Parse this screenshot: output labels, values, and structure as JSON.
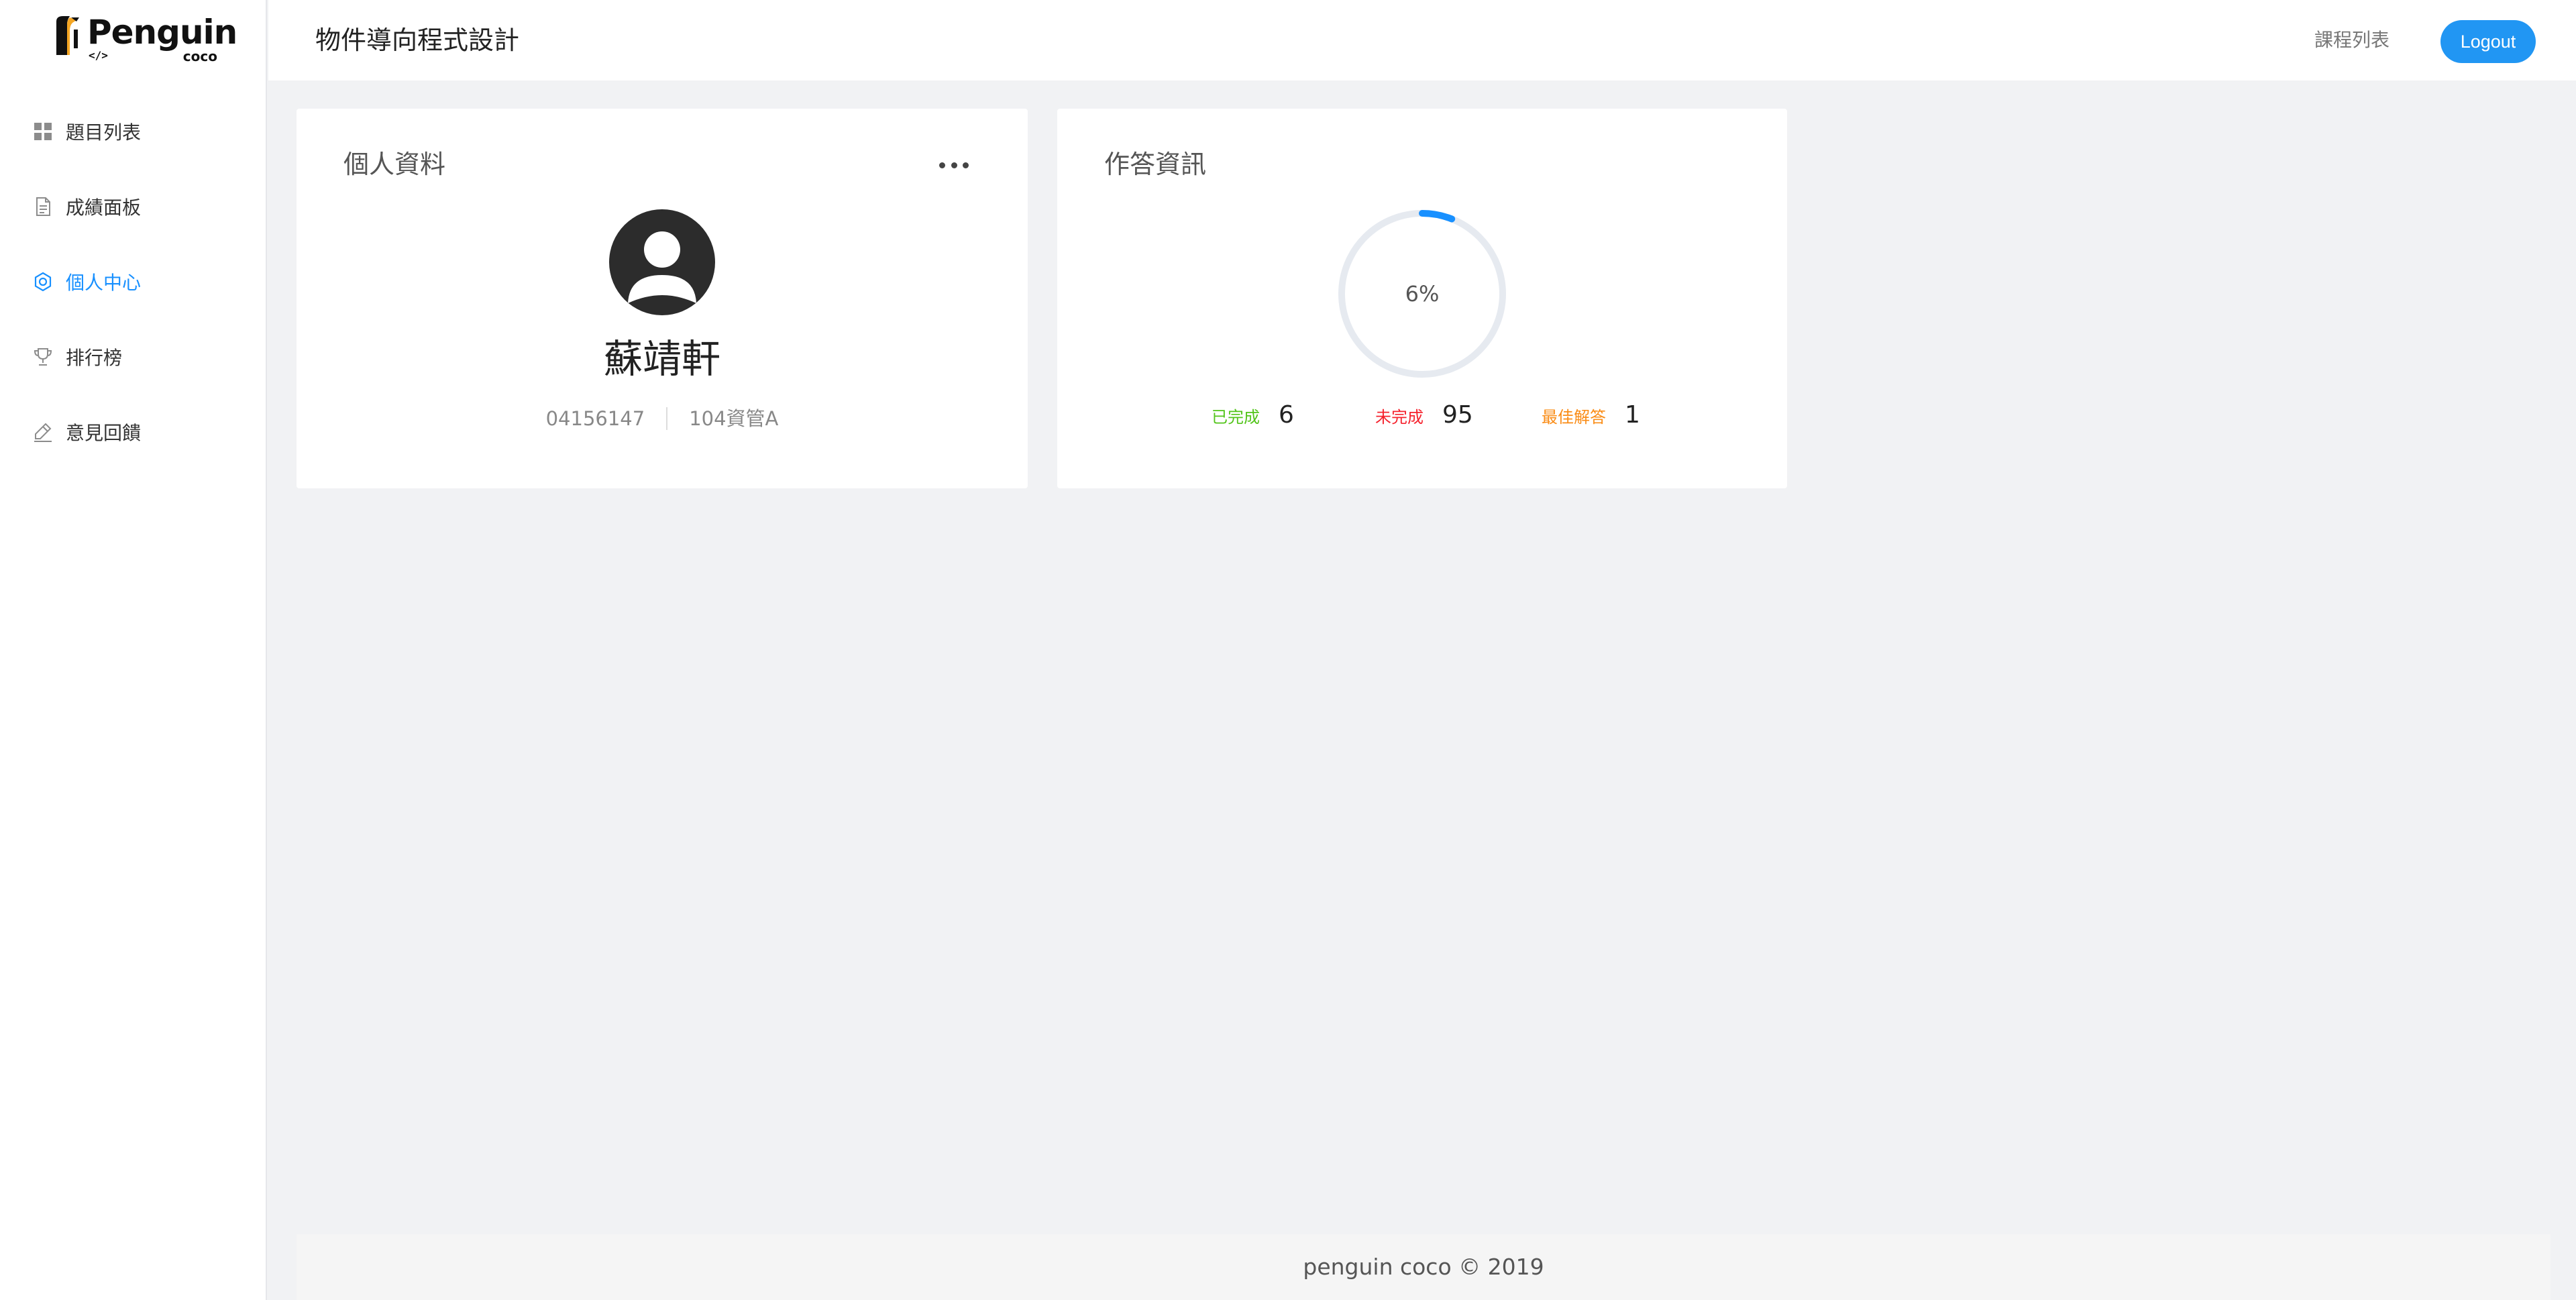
{
  "app": {
    "logo_word": "Penguin",
    "logo_code": "</>",
    "logo_sub": "coco"
  },
  "sidebar": {
    "items": [
      {
        "label": "題目列表",
        "icon": "grid-icon",
        "active": false
      },
      {
        "label": "成績面板",
        "icon": "document-icon",
        "active": false
      },
      {
        "label": "個人中心",
        "icon": "gear-icon",
        "active": true
      },
      {
        "label": "排行榜",
        "icon": "trophy-icon",
        "active": false
      },
      {
        "label": "意見回饋",
        "icon": "edit-icon",
        "active": false
      }
    ]
  },
  "header": {
    "title": "物件導向程式設計",
    "course_link": "課程列表",
    "logout_label": "Logout"
  },
  "profile": {
    "title": "個人資料",
    "name": "蘇靖軒",
    "student_id": "04156147",
    "class_name": "104資管A"
  },
  "answers": {
    "title": "作答資訊",
    "progress_text": "6%",
    "progress_fraction": 0.06,
    "completed_label": "已完成",
    "completed_value": "6",
    "incomplete_label": "未完成",
    "incomplete_value": "95",
    "best_label": "最佳解答",
    "best_value": "1"
  },
  "colors": {
    "accent": "#1890ff",
    "button": "#2196f3",
    "completed": "#52c41a",
    "incomplete": "#f5222d",
    "best": "#fa8c16",
    "ring_track": "#e6eaf0"
  },
  "footer": {
    "text": "penguin coco © 2019"
  }
}
